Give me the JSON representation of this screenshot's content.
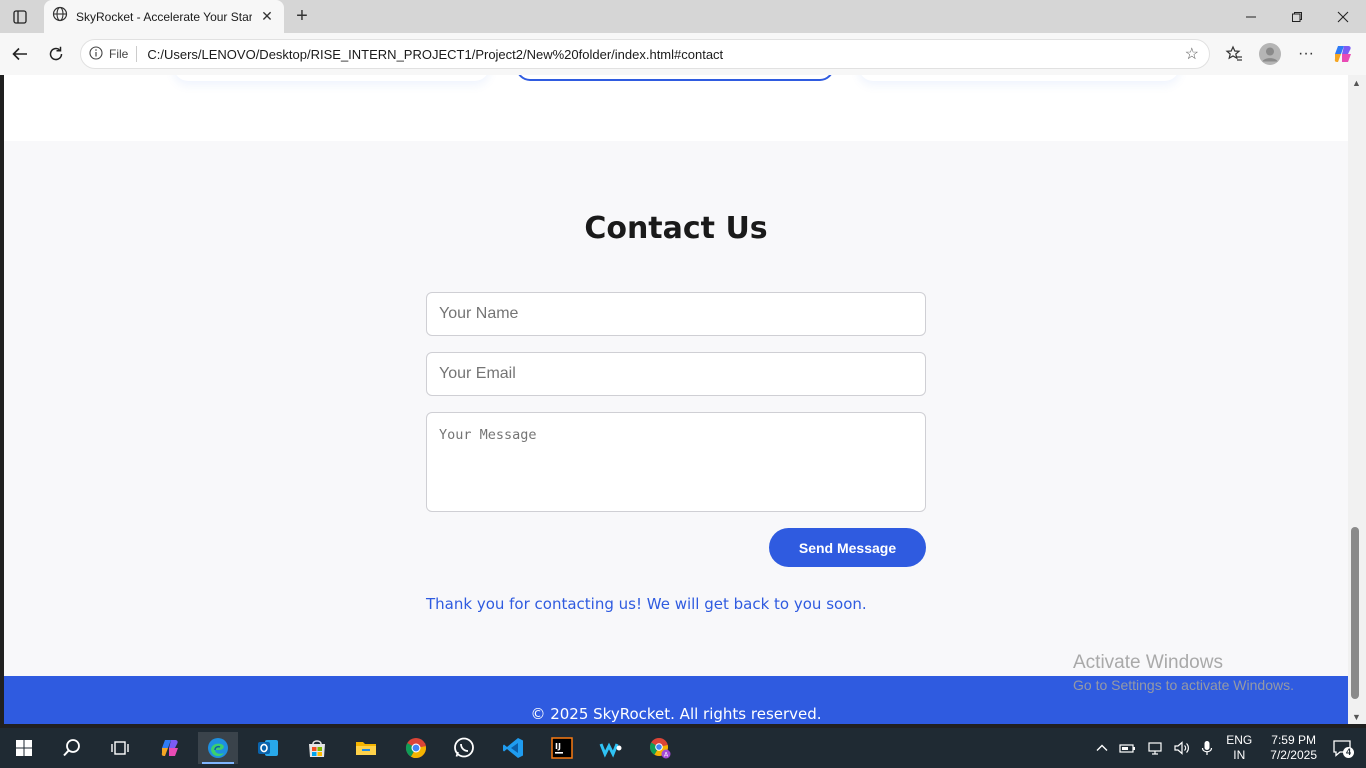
{
  "browser": {
    "tab_title": "SkyRocket - Accelerate Your Startup",
    "address_label": "File",
    "url": "C:/Users/LENOVO/Desktop/RISE_INTERN_PROJECT1/Project2/New%20folder/index.html#contact"
  },
  "contact": {
    "title": "Contact Us",
    "name_placeholder": "Your Name",
    "email_placeholder": "Your Email",
    "message_placeholder": "Your Message",
    "send_label": "Send Message",
    "thanks_text": "Thank you for contacting us! We will get back to you soon."
  },
  "footer": {
    "text": "© 2025 SkyRocket. All rights reserved."
  },
  "watermark": {
    "title": "Activate Windows",
    "subtitle": "Go to Settings to activate Windows."
  },
  "taskbar": {
    "lang_line1": "ENG",
    "lang_line2": "IN",
    "time": "7:59 PM",
    "date": "7/2/2025",
    "notification_count": "4"
  },
  "colors": {
    "accent": "#2f5be0",
    "page_bg": "#f8f8fa",
    "taskbar": "#1f2a33"
  }
}
